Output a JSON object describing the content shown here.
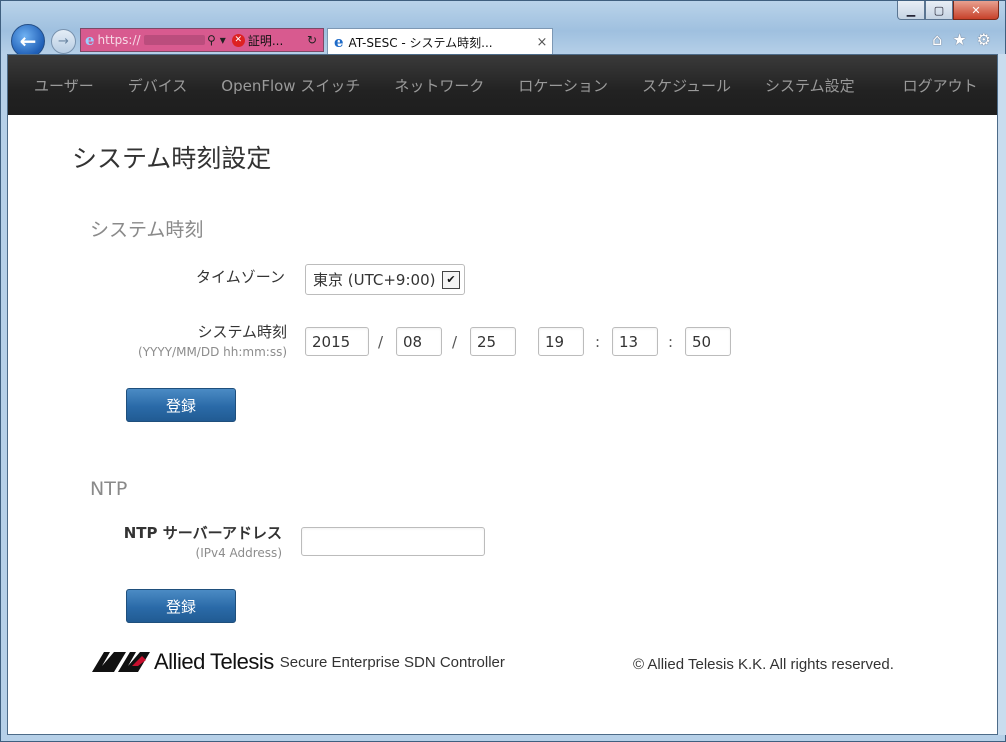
{
  "browser": {
    "address_prefix": "https://",
    "cert_error": "証明...",
    "tab_title": "AT-SESC - システム時刻...",
    "tab_close": "×",
    "window_buttons": {
      "minimize": "▁",
      "maximize": "▢",
      "close": "✕"
    },
    "toolbar_icons": [
      "home-icon",
      "favorites-star-icon",
      "settings-gear-icon"
    ]
  },
  "nav": {
    "items": [
      "ユーザー",
      "デバイス",
      "OpenFlow スイッチ",
      "ネットワーク",
      "ロケーション",
      "スケジュール",
      "システム設定"
    ],
    "logout": "ログアウト"
  },
  "page": {
    "title": "システム時刻設定",
    "system_time_section": {
      "heading": "システム時刻",
      "timezone_label": "タイムゾーン",
      "timezone_value": "東京 (UTC+9:00)",
      "time_label": "システム時刻",
      "time_format": "(YYYY/MM/DD hh:mm:ss)",
      "year": "2015",
      "month": "08",
      "day": "25",
      "hour": "19",
      "minute": "13",
      "second": "50",
      "date_sep": "/",
      "time_sep": ":",
      "submit": "登録"
    },
    "ntp_section": {
      "heading": "NTP",
      "server_label": "NTP サーバーアドレス",
      "server_hint": "(IPv4 Address)",
      "server_value": "",
      "submit": "登録"
    }
  },
  "footer": {
    "brand": "Allied Telesis",
    "product": "Secure Enterprise SDN Controller",
    "copyright": "© Allied Telesis K.K. All rights reserved."
  },
  "colors": {
    "nav_bg": "#222222",
    "nav_text": "#9a9a9a",
    "button": "#2a6aa8",
    "section_heading": "#8a8a8a"
  }
}
